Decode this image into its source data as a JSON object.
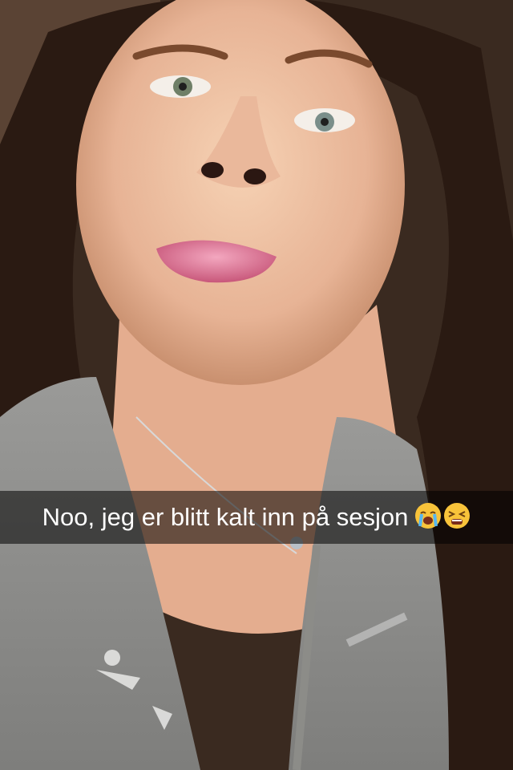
{
  "snap": {
    "caption": "Noo, jeg er blitt kalt inn på sesjon",
    "emojis": [
      "loudly-crying-face-icon",
      "tired-face-icon"
    ]
  },
  "colors": {
    "caption_bar": "#000000",
    "caption_text": "#ffffff"
  }
}
